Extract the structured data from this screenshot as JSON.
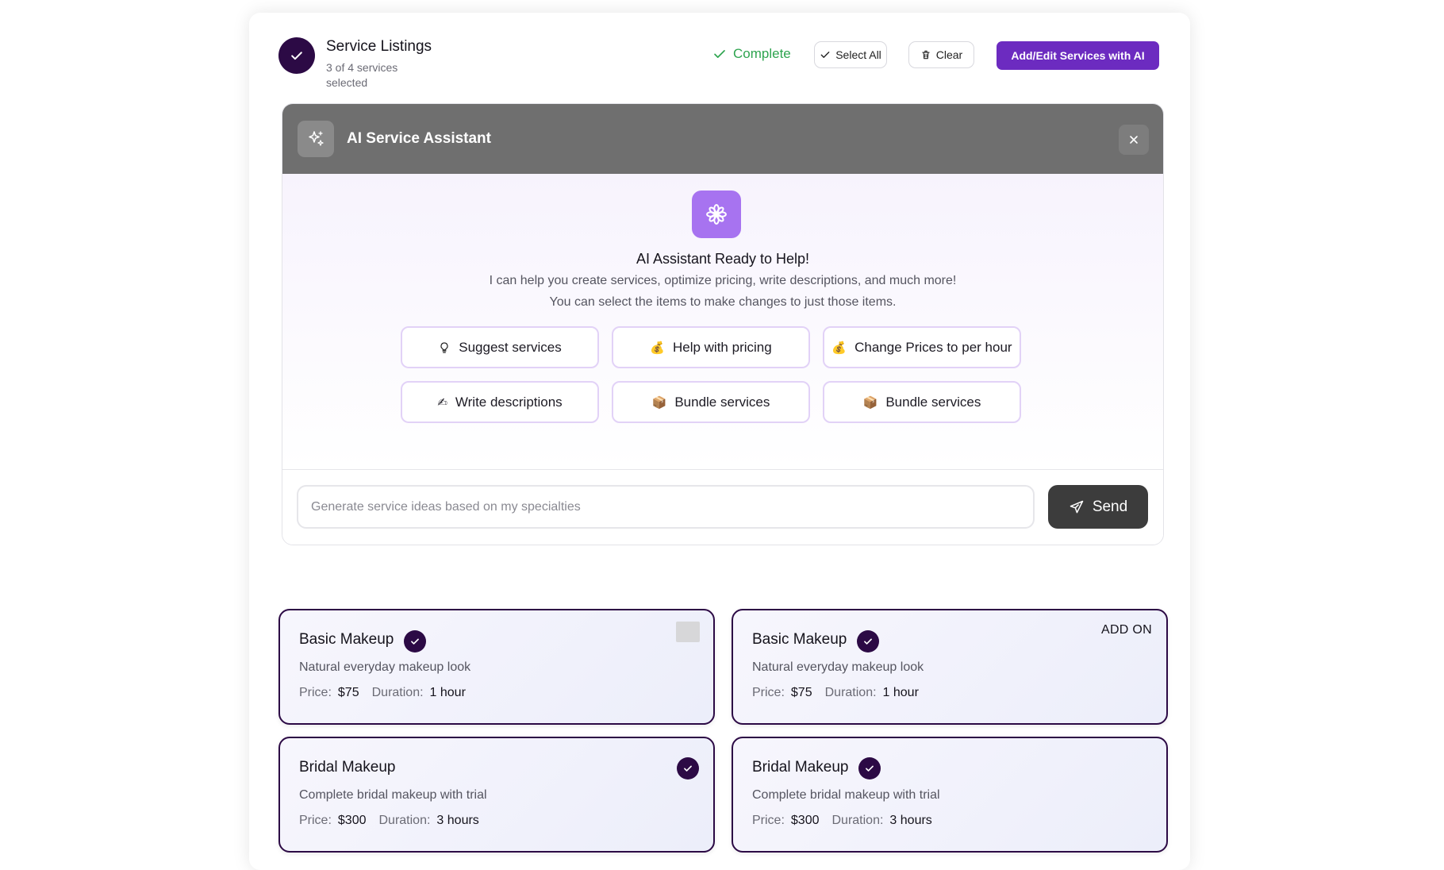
{
  "header": {
    "title": "Service Listings",
    "subtitle": "3 of 4 services selected",
    "status": "Complete",
    "select_all": "Select All",
    "clear": "Clear",
    "ai_button": "Add/Edit Services with AI",
    "accent": "#6c2bc0",
    "status_color": "#2ea44f"
  },
  "assistant": {
    "title": "AI Service Assistant",
    "ready_title": "AI Assistant Ready to Help!",
    "ready_line1": "I can help you create services, optimize pricing, write descriptions, and much more!",
    "ready_line2": "You can select the items  to make changes to just those items.",
    "chips": [
      {
        "icon": "lightbulb-icon",
        "label": "Suggest services"
      },
      {
        "icon": "money-bag-icon",
        "label": "Help with pricing"
      },
      {
        "icon": "money-bag-icon",
        "label": "Change Prices to per hour"
      },
      {
        "icon": "writing-hand-icon",
        "label": "Write descriptions"
      },
      {
        "icon": "package-icon",
        "label": "Bundle services"
      },
      {
        "icon": "package-icon",
        "label": "Bundle services"
      }
    ],
    "input_placeholder": "Generate service ideas based on my specialties",
    "send_label": "Send"
  },
  "services": [
    {
      "name": "Basic Makeup",
      "description": "Natural everyday makeup look",
      "price_label": "Price:",
      "price": "$75",
      "duration_label": "Duration:",
      "duration": "1 hour",
      "selected": true
    },
    {
      "name": "Basic Makeup",
      "description": "Natural everyday makeup look",
      "price_label": "Price:",
      "price": "$75",
      "duration_label": "Duration:",
      "duration": "1 hour",
      "selected": true,
      "tag": "ADD ON"
    },
    {
      "name": "Bridal Makeup",
      "description": "Complete bridal makeup with trial",
      "price_label": "Price:",
      "price": "$300",
      "duration_label": "Duration:",
      "duration": "3 hours",
      "selected": true
    },
    {
      "name": "Bridal Makeup",
      "description": "Complete bridal makeup with trial",
      "price_label": "Price:",
      "price": "$300",
      "duration_label": "Duration:",
      "duration": "3 hours",
      "selected": true
    }
  ]
}
